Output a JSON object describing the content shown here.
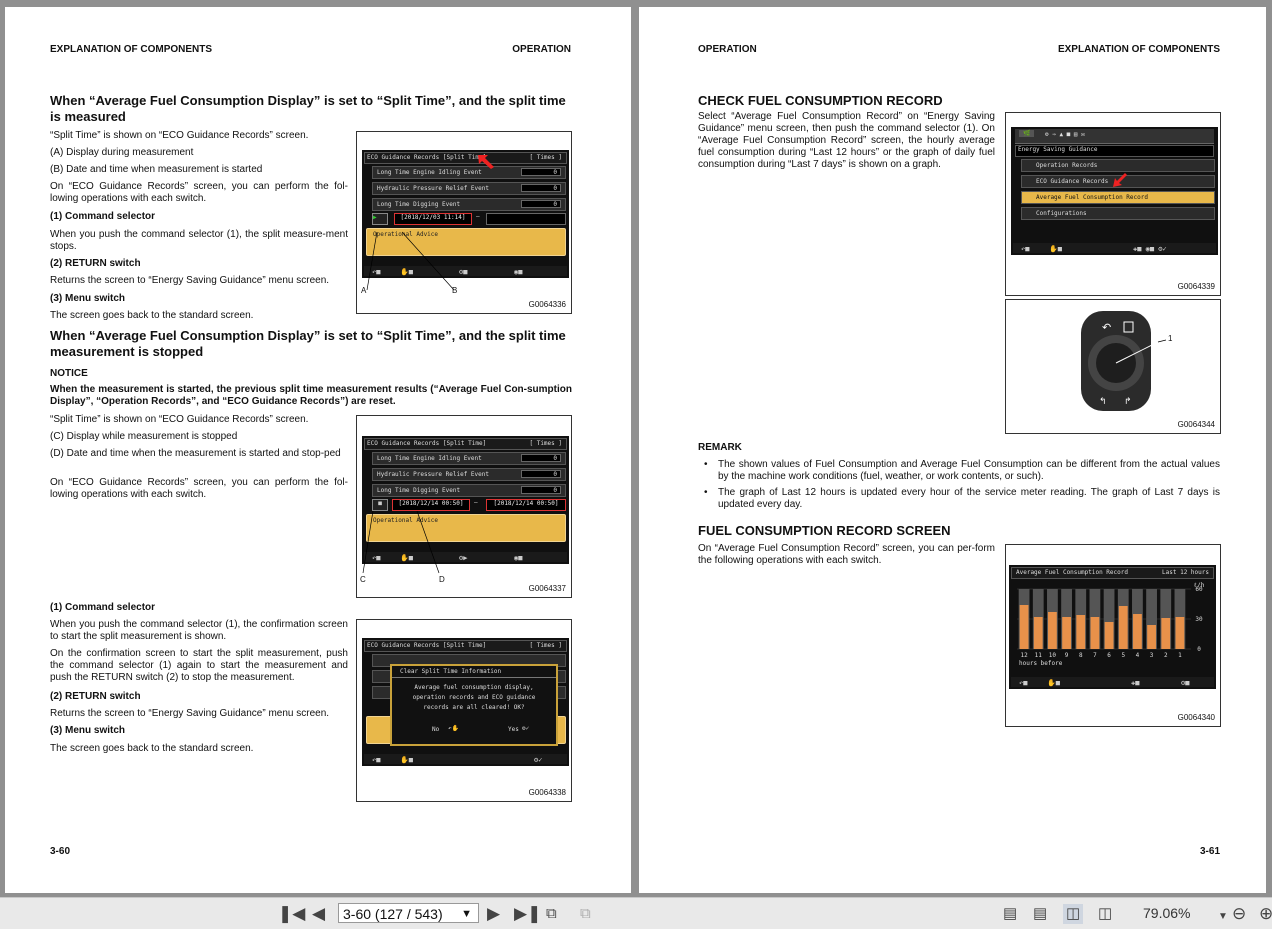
{
  "left": {
    "header_left": "EXPLANATION OF COMPONENTS",
    "header_right": "OPERATION",
    "s1_heading": "When “Average Fuel Consumption Display” is set to “Split Time”, and the split time is measured",
    "s1_p1": "“Split Time” is shown on “ECO Guidance Records” screen.",
    "s1_a": "(A) Display during measurement",
    "s1_b": "(B) Date and time when measurement is started",
    "s1_p2": "On “ECO Guidance Records” screen, you can perform the fol-lowing operations with each switch.",
    "s1_cmd_h": "(1) Command selector",
    "s1_cmd_t": "When you push the command selector (1), the split measure-ment stops.",
    "s1_ret_h": "(2) RETURN switch",
    "s1_ret_t": "Returns the screen to “Energy Saving Guidance” menu screen.",
    "s1_menu_h": "(3) Menu switch",
    "s1_menu_t": "The screen goes back to the standard screen.",
    "s2_heading": "When “Average Fuel Consumption Display” is set to “Split Time”, and the split time measurement is stopped",
    "notice_h": "NOTICE",
    "notice_t": "When the measurement is started, the previous split time measurement results (“Average Fuel Con-sumption Display”, “Operation Records”, and “ECO Guidance Records”) are reset.",
    "s2_p1": "“Split Time” is shown on “ECO Guidance Records” screen.",
    "s2_c": "(C) Display while measurement is stopped",
    "s2_d": "(D) Date and time when the measurement is started and stop-ped",
    "s2_p2": "On “ECO Guidance Records” screen, you can perform the fol-lowing operations with each switch.",
    "s3_cmd_h": "(1) Command selector",
    "s3_cmd_t1": "When you push the command selector (1), the confirmation screen to start the split measurement is shown.",
    "s3_cmd_t2": "On the confirmation screen to start the split measurement, push the command selector (1) again to start the measurement and push the RETURN switch (2) to stop the measurement.",
    "s3_ret_h": "(2) RETURN switch",
    "s3_ret_t": "Returns the screen to “Energy Saving Guidance” menu screen.",
    "s3_menu_h": "(3) Menu switch",
    "s3_menu_t": "The screen goes back to the standard screen.",
    "page_no": "3-60",
    "fig1": {
      "title": "ECO Guidance Records [Split Time]",
      "title_right": "[ Times ]",
      "rows": [
        "Long Time Engine Idling Event",
        "Hydraulic Pressure Relief Event",
        "Long Time Digging Event"
      ],
      "values": [
        "0",
        "0",
        "0"
      ],
      "date": "[2018/12/03 11:14]",
      "dash": "–",
      "advice": "Operational Advice",
      "label_a": "A",
      "label_b": "B",
      "code": "G0064336"
    },
    "fig2": {
      "title": "ECO Guidance Records [Split Time]",
      "title_right": "[ Times ]",
      "rows": [
        "Long Time Engine Idling Event",
        "Hydraulic Pressure Relief Event",
        "Long Time Digging Event"
      ],
      "values": [
        "0",
        "0",
        "0"
      ],
      "date_start": "[2018/12/14 00:50]",
      "date_end": "[2018/12/14 00:50]",
      "dash": "–",
      "advice": "Operational Advice",
      "label_c": "C",
      "label_d": "D",
      "code": "G0064337"
    },
    "fig3": {
      "title": "ECO Guidance Records [Split Time]",
      "title_right": "[ Times ]",
      "dialog_title": "Clear Split Time Information",
      "dialog_text1": "Average fuel consumption display,",
      "dialog_text2": "operation records and ECO guidance",
      "dialog_text3": "records are all cleared! OK?",
      "no_label": "No",
      "yes_label": "Yes",
      "code": "G0064338"
    }
  },
  "right": {
    "header_left": "OPERATION",
    "header_right": "EXPLANATION OF COMPONENTS",
    "check_h": "CHECK FUEL CONSUMPTION RECORD",
    "check_t": "Select “Average Fuel Consumption Record” on “Energy Saving Guidance” menu screen, then push the command selector (1). On “Average Fuel Consumption Record” screen, the hourly average fuel consumption during “Last 12 hours” or the graph of daily fuel consumption during “Last 7 days” is shown on a graph.",
    "remark_h": "REMARK",
    "remark_items": [
      "The shown values of Fuel Consumption and Average Fuel Consumption can be different from the actual values by the machine work conditions (fuel, weather, or work contents, or such).",
      "The graph of Last 12 hours is updated every hour of the service meter reading. The graph of Last 7 days is updated every day."
    ],
    "record_h": "FUEL CONSUMPTION RECORD SCREEN",
    "record_t": "On “Average Fuel Consumption Record” screen, you can per-form the following operations with each switch.",
    "page_no": "3-61",
    "fig4": {
      "menu_title": "Energy Saving Guidance",
      "items": [
        "Operation Records",
        "ECO Guidance Records",
        "Average Fuel Consumption Record",
        "Configurations"
      ],
      "code": "G0064339"
    },
    "fig5": {
      "label_1": "1",
      "code": "G0064344"
    },
    "fig6": {
      "title": "Average Fuel Consumption Record",
      "title_right": "Last 12 hours",
      "unit": "ℓ/h",
      "y_ticks": [
        "60",
        "30",
        "0"
      ],
      "x_labels": [
        "12",
        "11",
        "10",
        "9",
        "8",
        "7",
        "6",
        "5",
        "4",
        "3",
        "2",
        "1"
      ],
      "x_caption": "hours before",
      "code": "G0064340"
    }
  },
  "chart_data": {
    "type": "bar",
    "title": "Average Fuel Consumption Record",
    "subtitle": "Last 12 hours",
    "ylabel": "ℓ/h",
    "xlabel": "hours before",
    "categories": [
      "12",
      "11",
      "10",
      "9",
      "8",
      "7",
      "6",
      "5",
      "4",
      "3",
      "2",
      "1"
    ],
    "values": [
      44,
      32,
      37,
      32,
      34,
      32,
      27,
      43,
      35,
      24,
      31,
      32
    ],
    "ylim": [
      0,
      60
    ],
    "bar_color": "#e8914a"
  },
  "toolbar": {
    "page_field": "3-60 (127 / 543)",
    "zoom": "79.06%"
  }
}
